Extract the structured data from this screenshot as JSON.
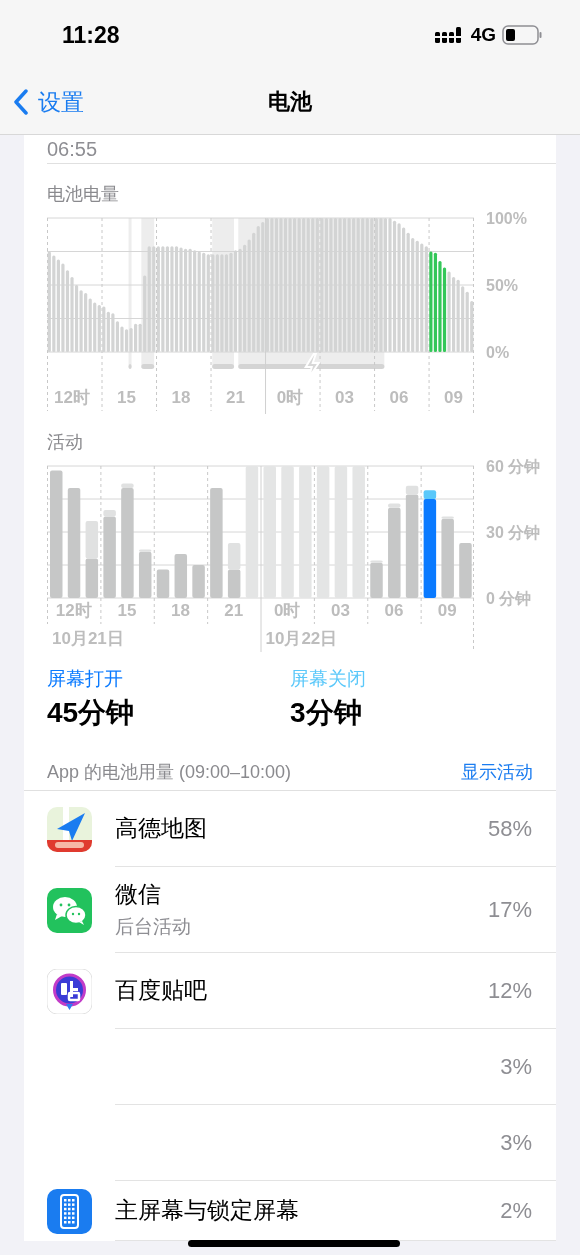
{
  "status_bar": {
    "time": "11:28",
    "network": "4G"
  },
  "nav": {
    "back": "设置",
    "title": "电池"
  },
  "top_value": "06:55",
  "battery_level": {
    "title": "电池电量",
    "chart_data": {
      "type": "bar",
      "stacked": true,
      "ylim": [
        0,
        100
      ],
      "yticks": [
        {
          "value": 0,
          "label": "0%"
        },
        {
          "value": 50,
          "label": "50%"
        },
        {
          "value": 100,
          "label": "100%"
        }
      ],
      "categories": [
        null,
        null,
        null,
        null,
        null,
        "12时",
        null,
        null,
        null,
        null,
        null,
        null,
        null,
        null,
        null,
        null,
        null,
        "15",
        null,
        null,
        null,
        null,
        null,
        null,
        null,
        null,
        null,
        null,
        null,
        "18",
        null,
        null,
        null,
        null,
        null,
        null,
        null,
        null,
        null,
        null,
        null,
        "21",
        null,
        null,
        null,
        null,
        null,
        null,
        null,
        null,
        null,
        null,
        null,
        "0时",
        null,
        null,
        null,
        null,
        null,
        null,
        null,
        null,
        null,
        null,
        null,
        "03",
        null,
        null,
        null,
        null,
        null,
        null,
        null,
        null,
        null,
        null,
        null,
        "06",
        null,
        null,
        null,
        null,
        null,
        null,
        null,
        null,
        null,
        null,
        null,
        "09",
        null,
        null,
        null,
        null
      ],
      "series": [
        {
          "color": "#d3d4d4",
          "values": [
            75,
            72,
            69,
            66,
            61,
            56,
            50,
            46,
            44,
            40,
            37,
            35,
            34,
            30,
            29,
            23,
            19,
            17,
            18,
            21,
            21,
            57,
            79,
            79,
            79,
            79,
            79,
            79,
            79,
            78,
            77,
            77,
            76,
            75,
            74,
            73,
            73,
            73,
            73,
            73,
            74,
            76,
            77,
            80,
            84,
            89,
            94,
            97,
            100,
            100,
            100,
            100,
            100,
            100,
            100,
            100,
            100,
            100,
            100,
            100,
            100,
            100,
            100,
            100,
            100,
            100,
            100,
            100,
            100,
            100,
            100,
            100,
            100,
            100,
            100,
            100,
            98,
            96,
            93,
            89,
            85,
            83,
            81,
            79,
            null,
            null,
            null,
            null,
            60,
            56,
            54,
            49,
            45,
            38
          ]
        },
        {
          "color": "#34c759",
          "values": [
            null,
            null,
            null,
            null,
            null,
            null,
            null,
            null,
            null,
            null,
            null,
            null,
            null,
            null,
            null,
            null,
            null,
            null,
            null,
            null,
            null,
            null,
            null,
            null,
            null,
            null,
            null,
            null,
            null,
            null,
            null,
            null,
            null,
            null,
            null,
            null,
            null,
            null,
            null,
            null,
            null,
            null,
            null,
            null,
            null,
            null,
            null,
            null,
            null,
            null,
            null,
            null,
            null,
            null,
            null,
            null,
            null,
            null,
            null,
            null,
            null,
            null,
            null,
            null,
            null,
            null,
            null,
            null,
            null,
            null,
            null,
            null,
            null,
            null,
            null,
            null,
            null,
            null,
            null,
            null,
            null,
            null,
            null,
            null,
            75,
            74,
            68,
            63,
            null,
            null,
            null,
            null,
            null,
            null
          ]
        }
      ],
      "grid": true
    }
  },
  "activity": {
    "title": "活动",
    "chart_data": {
      "type": "bar",
      "stacked": true,
      "ylim": [
        0,
        60
      ],
      "yticks": [
        {
          "value": 0,
          "label": "0 分钟"
        },
        {
          "value": 30,
          "label": "30 分钟"
        },
        {
          "value": 60,
          "label": "60 分钟"
        }
      ],
      "categories": [
        null,
        "12时",
        null,
        null,
        "15",
        null,
        null,
        "18",
        null,
        null,
        "21",
        null,
        null,
        "0时",
        null,
        null,
        "03",
        null,
        null,
        "06",
        null,
        null,
        "09",
        null
      ],
      "series": [
        {
          "color": "#c6c7c7",
          "values": [
            58,
            50,
            18,
            37,
            50,
            21,
            13,
            20,
            15,
            50,
            13,
            null,
            null,
            null,
            null,
            null,
            null,
            null,
            16,
            41,
            47,
            null,
            36,
            25
          ]
        },
        {
          "color": "#e0e1e1",
          "values": [
            0,
            0,
            17,
            3,
            2,
            1,
            0,
            0,
            0,
            0,
            12,
            null,
            null,
            null,
            null,
            null,
            null,
            null,
            1,
            2,
            4,
            null,
            1,
            0
          ]
        },
        {
          "color": "#e4e5e5",
          "values": [
            null,
            null,
            null,
            null,
            null,
            null,
            null,
            null,
            null,
            null,
            null,
            60,
            60,
            60,
            60,
            60,
            60,
            60,
            null,
            null,
            null,
            null,
            null,
            null
          ]
        },
        {
          "color": "#0a7aff",
          "values": [
            null,
            null,
            null,
            null,
            null,
            null,
            null,
            null,
            null,
            null,
            null,
            null,
            null,
            null,
            null,
            null,
            null,
            null,
            null,
            null,
            null,
            45,
            null,
            null
          ]
        },
        {
          "color": "#5ac8fa",
          "values": [
            null,
            null,
            null,
            null,
            null,
            null,
            null,
            null,
            null,
            null,
            null,
            null,
            null,
            null,
            null,
            null,
            null,
            null,
            null,
            null,
            null,
            4,
            null,
            null
          ]
        }
      ],
      "annotations": [
        "10月21日",
        "10月22日"
      ],
      "grid": true
    }
  },
  "legend": [
    {
      "label": "屏幕打开",
      "value": "45分钟",
      "color": "#0a7aff"
    },
    {
      "label": "屏幕关闭",
      "value": "3分钟",
      "color": "#5ac8fa"
    }
  ],
  "usage": {
    "title": "App 的电池用量 (09:00–10:00)",
    "action": "显示活动",
    "apps": [
      {
        "kind": "amap",
        "name": "高德地图",
        "percent": "58%"
      },
      {
        "kind": "wechat",
        "name": "微信",
        "detail": "后台活动",
        "percent": "17%"
      },
      {
        "kind": "tieba",
        "name": "百度贴吧",
        "percent": "12%"
      },
      {
        "kind": "hidden",
        "percent": "3%"
      },
      {
        "kind": "hidden",
        "percent": "3%"
      },
      {
        "kind": "homescreen",
        "name": "主屏幕与锁定屏幕",
        "percent": "2%"
      }
    ]
  }
}
